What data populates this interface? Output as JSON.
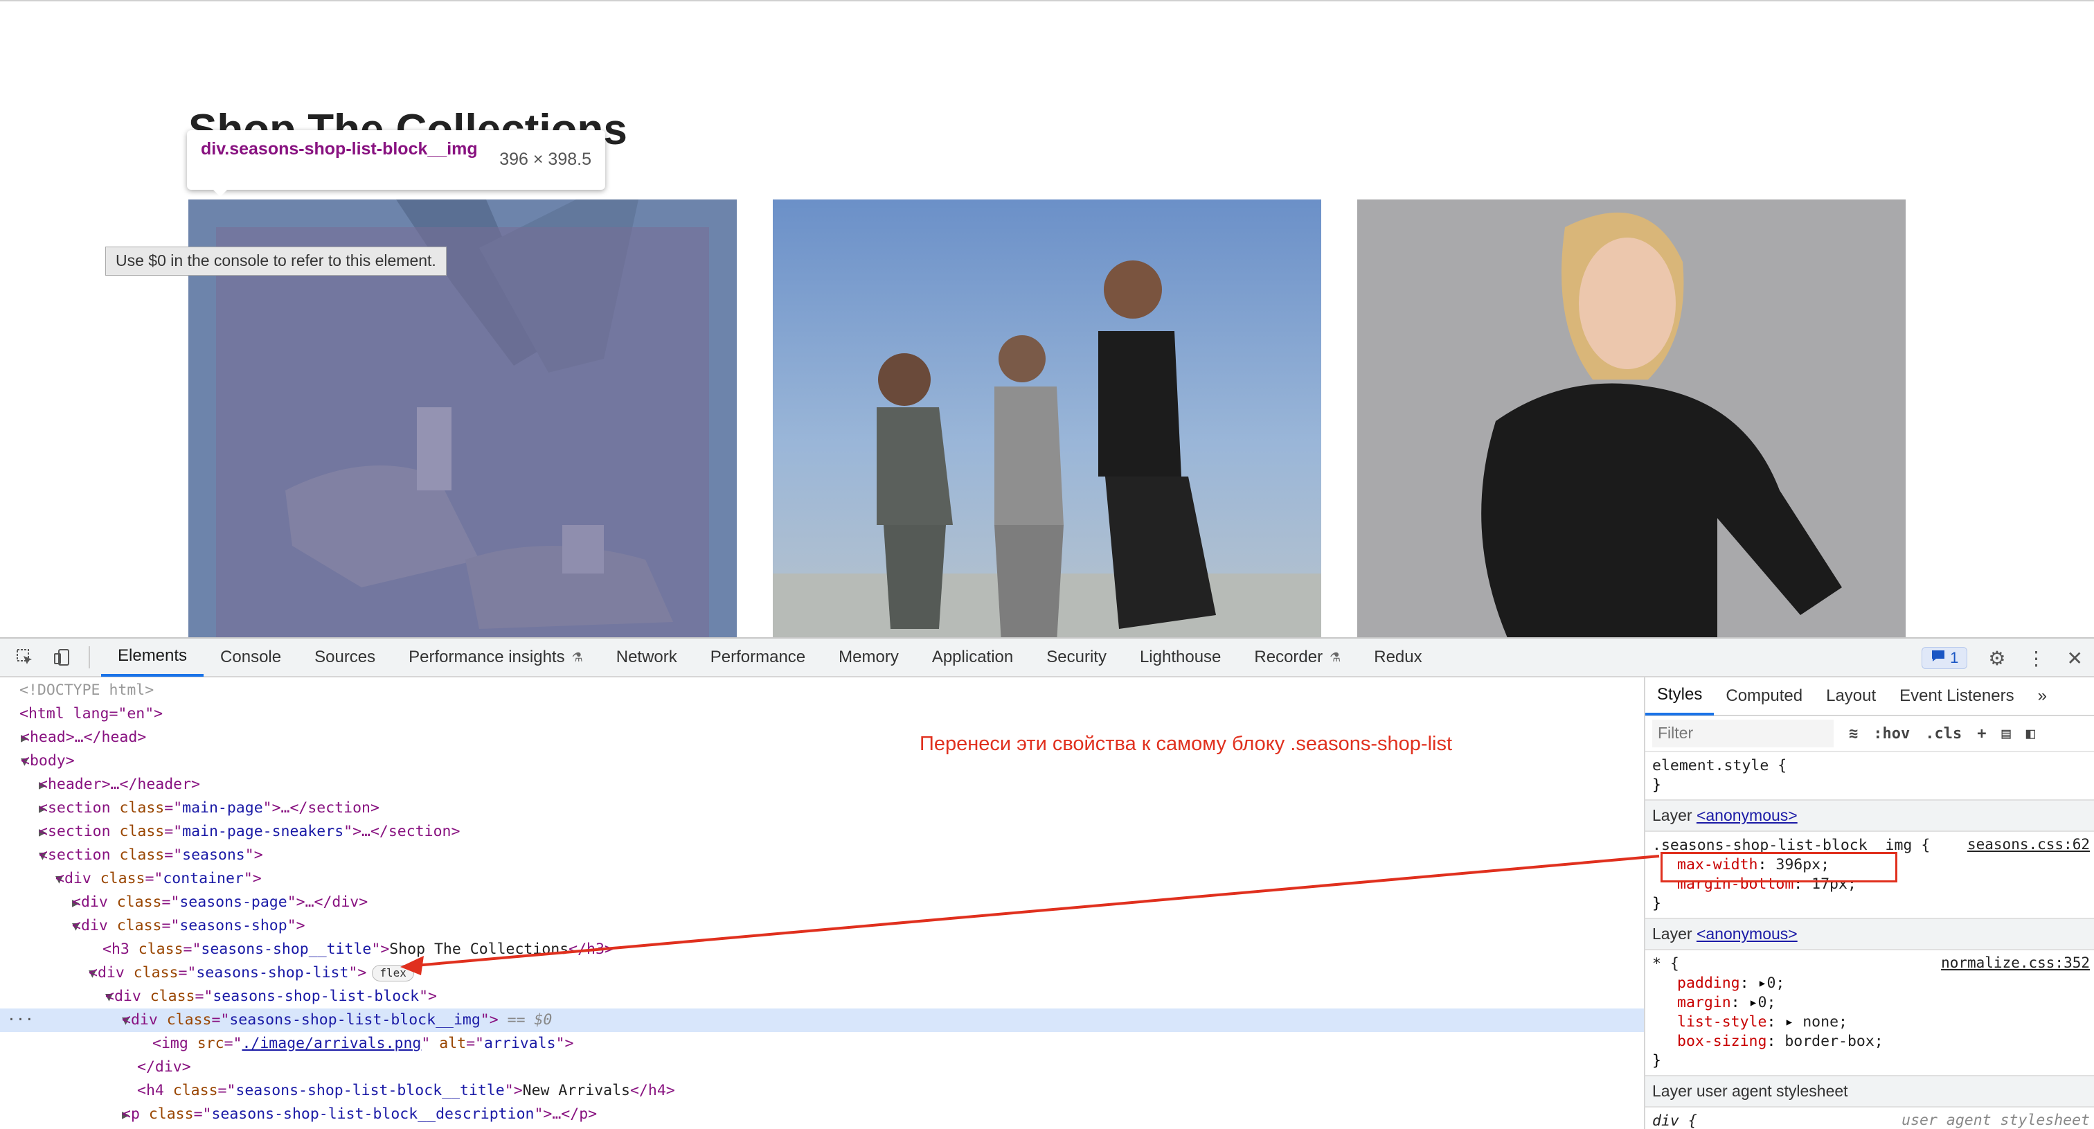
{
  "page": {
    "heading": "Shop The Collections",
    "inspect_tooltip": {
      "selector": "div.seasons-shop-list-block__img",
      "dimensions": "396 × 398.5"
    },
    "console_hint": "Use $0 in the console to refer to this element."
  },
  "devtools": {
    "tabs": [
      "Elements",
      "Console",
      "Sources",
      "Performance insights",
      "Network",
      "Performance",
      "Memory",
      "Application",
      "Security",
      "Lighthouse",
      "Recorder",
      "Redux"
    ],
    "active_tab": "Elements",
    "issues_count": "1",
    "annotation": "Перенеси эти свойства к самому блоку .seasons-shop-list",
    "dom": {
      "doctype": "<!DOCTYPE html>",
      "html_open": "<html lang=\"en\">",
      "head": "<head>…</head>",
      "body_open": "<body>",
      "header": "<header>…</header>",
      "main_page": "main-page",
      "main_page_sneakers": "main-page-sneakers",
      "seasons": "seasons",
      "container": "container",
      "seasons_page": "seasons-page",
      "seasons_shop": "seasons-shop",
      "title_class": "seasons-shop__title",
      "title_text": "Shop The Collections",
      "list_class": "seasons-shop-list",
      "flex_badge": "flex",
      "block_class": "seasons-shop-list-block",
      "img_block_class": "seasons-shop-list-block__img",
      "selected_marker": "== $0",
      "img_src": "./image/arrivals.png",
      "img_alt": "arrivals",
      "h4_class": "seasons-shop-list-block__title",
      "h4_text": "New Arrivals",
      "p_class": "seasons-shop-list-block__description"
    },
    "styles": {
      "tabs": [
        "Styles",
        "Computed",
        "Layout",
        "Event Listeners"
      ],
      "active_tab": "Styles",
      "filter_placeholder": "Filter",
      "hov": ":hov",
      "cls": ".cls",
      "element_style": "element.style {",
      "layer1": "Layer",
      "layer1_link": "<anonymous>",
      "rule1_selector": ".seasons-shop-list-block__img {",
      "rule1_source": "seasons.css:62",
      "rule1_props": [
        {
          "name": "max-width",
          "value": "396px;"
        },
        {
          "name": "margin-bottom",
          "value": "17px;"
        }
      ],
      "layer2": "Layer",
      "layer2_link": "<anonymous>",
      "rule2_selector": "* {",
      "rule2_source": "normalize.css:352",
      "rule2_props": [
        {
          "name": "padding",
          "value": "0;"
        },
        {
          "name": "margin",
          "value": "0;"
        },
        {
          "name": "list-style",
          "value": "none;"
        },
        {
          "name": "box-sizing",
          "value": "border-box;"
        }
      ],
      "layer3": "Layer user agent stylesheet",
      "rule3_selector": "div {",
      "rule3_source": "user agent stylesheet"
    }
  },
  "colors": {
    "annotation": "#e0301e",
    "selection": "#d8e6fb",
    "accent": "#1a73e8"
  }
}
